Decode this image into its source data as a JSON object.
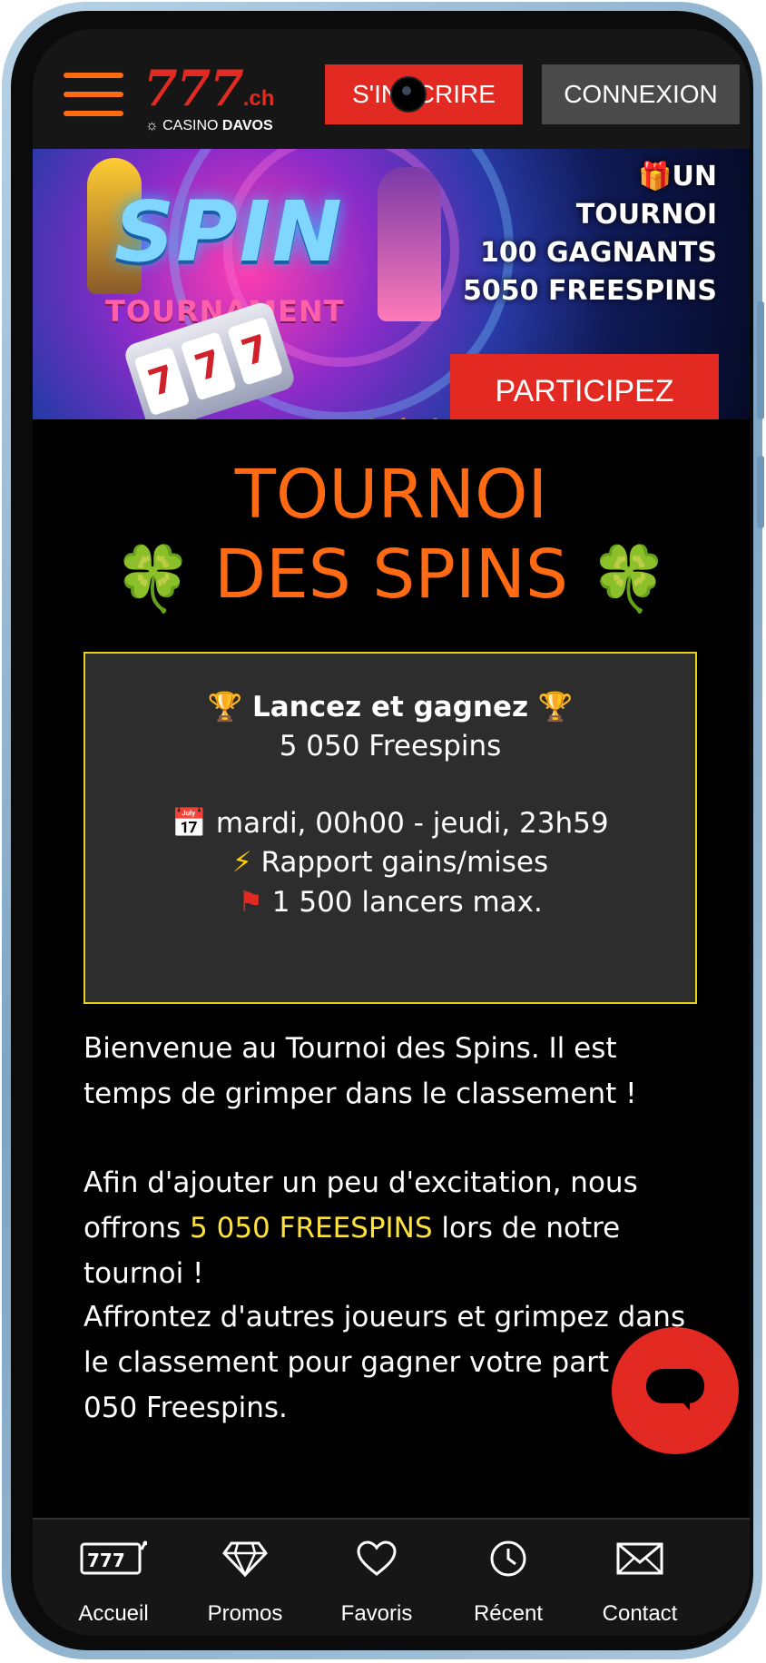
{
  "header": {
    "logo_number": "777",
    "logo_suffix": ".ch",
    "logo_casino": "CASINO",
    "logo_davos": "DAVOS",
    "signup_label": "S'INSCRIRE",
    "login_label": "CONNEXION"
  },
  "banner": {
    "spin_text": "SPIN",
    "tournament_text": "TOURNAMENT",
    "line1": "UN",
    "line2": "TOURNOI",
    "line3": "100 GAGNANTS",
    "line4": "5050 FREESPINS",
    "cta_label": "PARTICIPEZ"
  },
  "main": {
    "title_line1": "TOURNOI",
    "title_line2": "DES SPINS",
    "info": {
      "heading": "Lancez et gagnez",
      "freespins": "5 050 Freespins",
      "schedule": "mardi, 00h00 - jeudi, 23h59",
      "ratio": "Rapport gains/mises",
      "max_spins": "1 500 lancers max."
    },
    "paragraph1": "Bienvenue au Tournoi des Spins. Il est temps de grimper dans le classement !",
    "paragraph2_before": "Afin d'ajouter un peu d'excitation, nous offrons ",
    "paragraph2_highlight": "5 050 FREESPINS",
    "paragraph2_after": " lors de notre tournoi !",
    "paragraph3": "Affrontez d'autres joueurs et grimpez dans le classement pour gagner votre part des 5 050 Freespins."
  },
  "bottom_nav": [
    {
      "label": "Accueil",
      "icon": "slot-machine-icon"
    },
    {
      "label": "Promos",
      "icon": "diamond-icon"
    },
    {
      "label": "Favoris",
      "icon": "heart-icon"
    },
    {
      "label": "Récent",
      "icon": "clock-icon"
    },
    {
      "label": "Contact",
      "icon": "envelope-icon"
    }
  ],
  "colors": {
    "accent_orange": "#ff6a13",
    "brand_red": "#e22a22",
    "highlight_yellow": "#ffe23a",
    "box_border": "#e8d21a"
  }
}
